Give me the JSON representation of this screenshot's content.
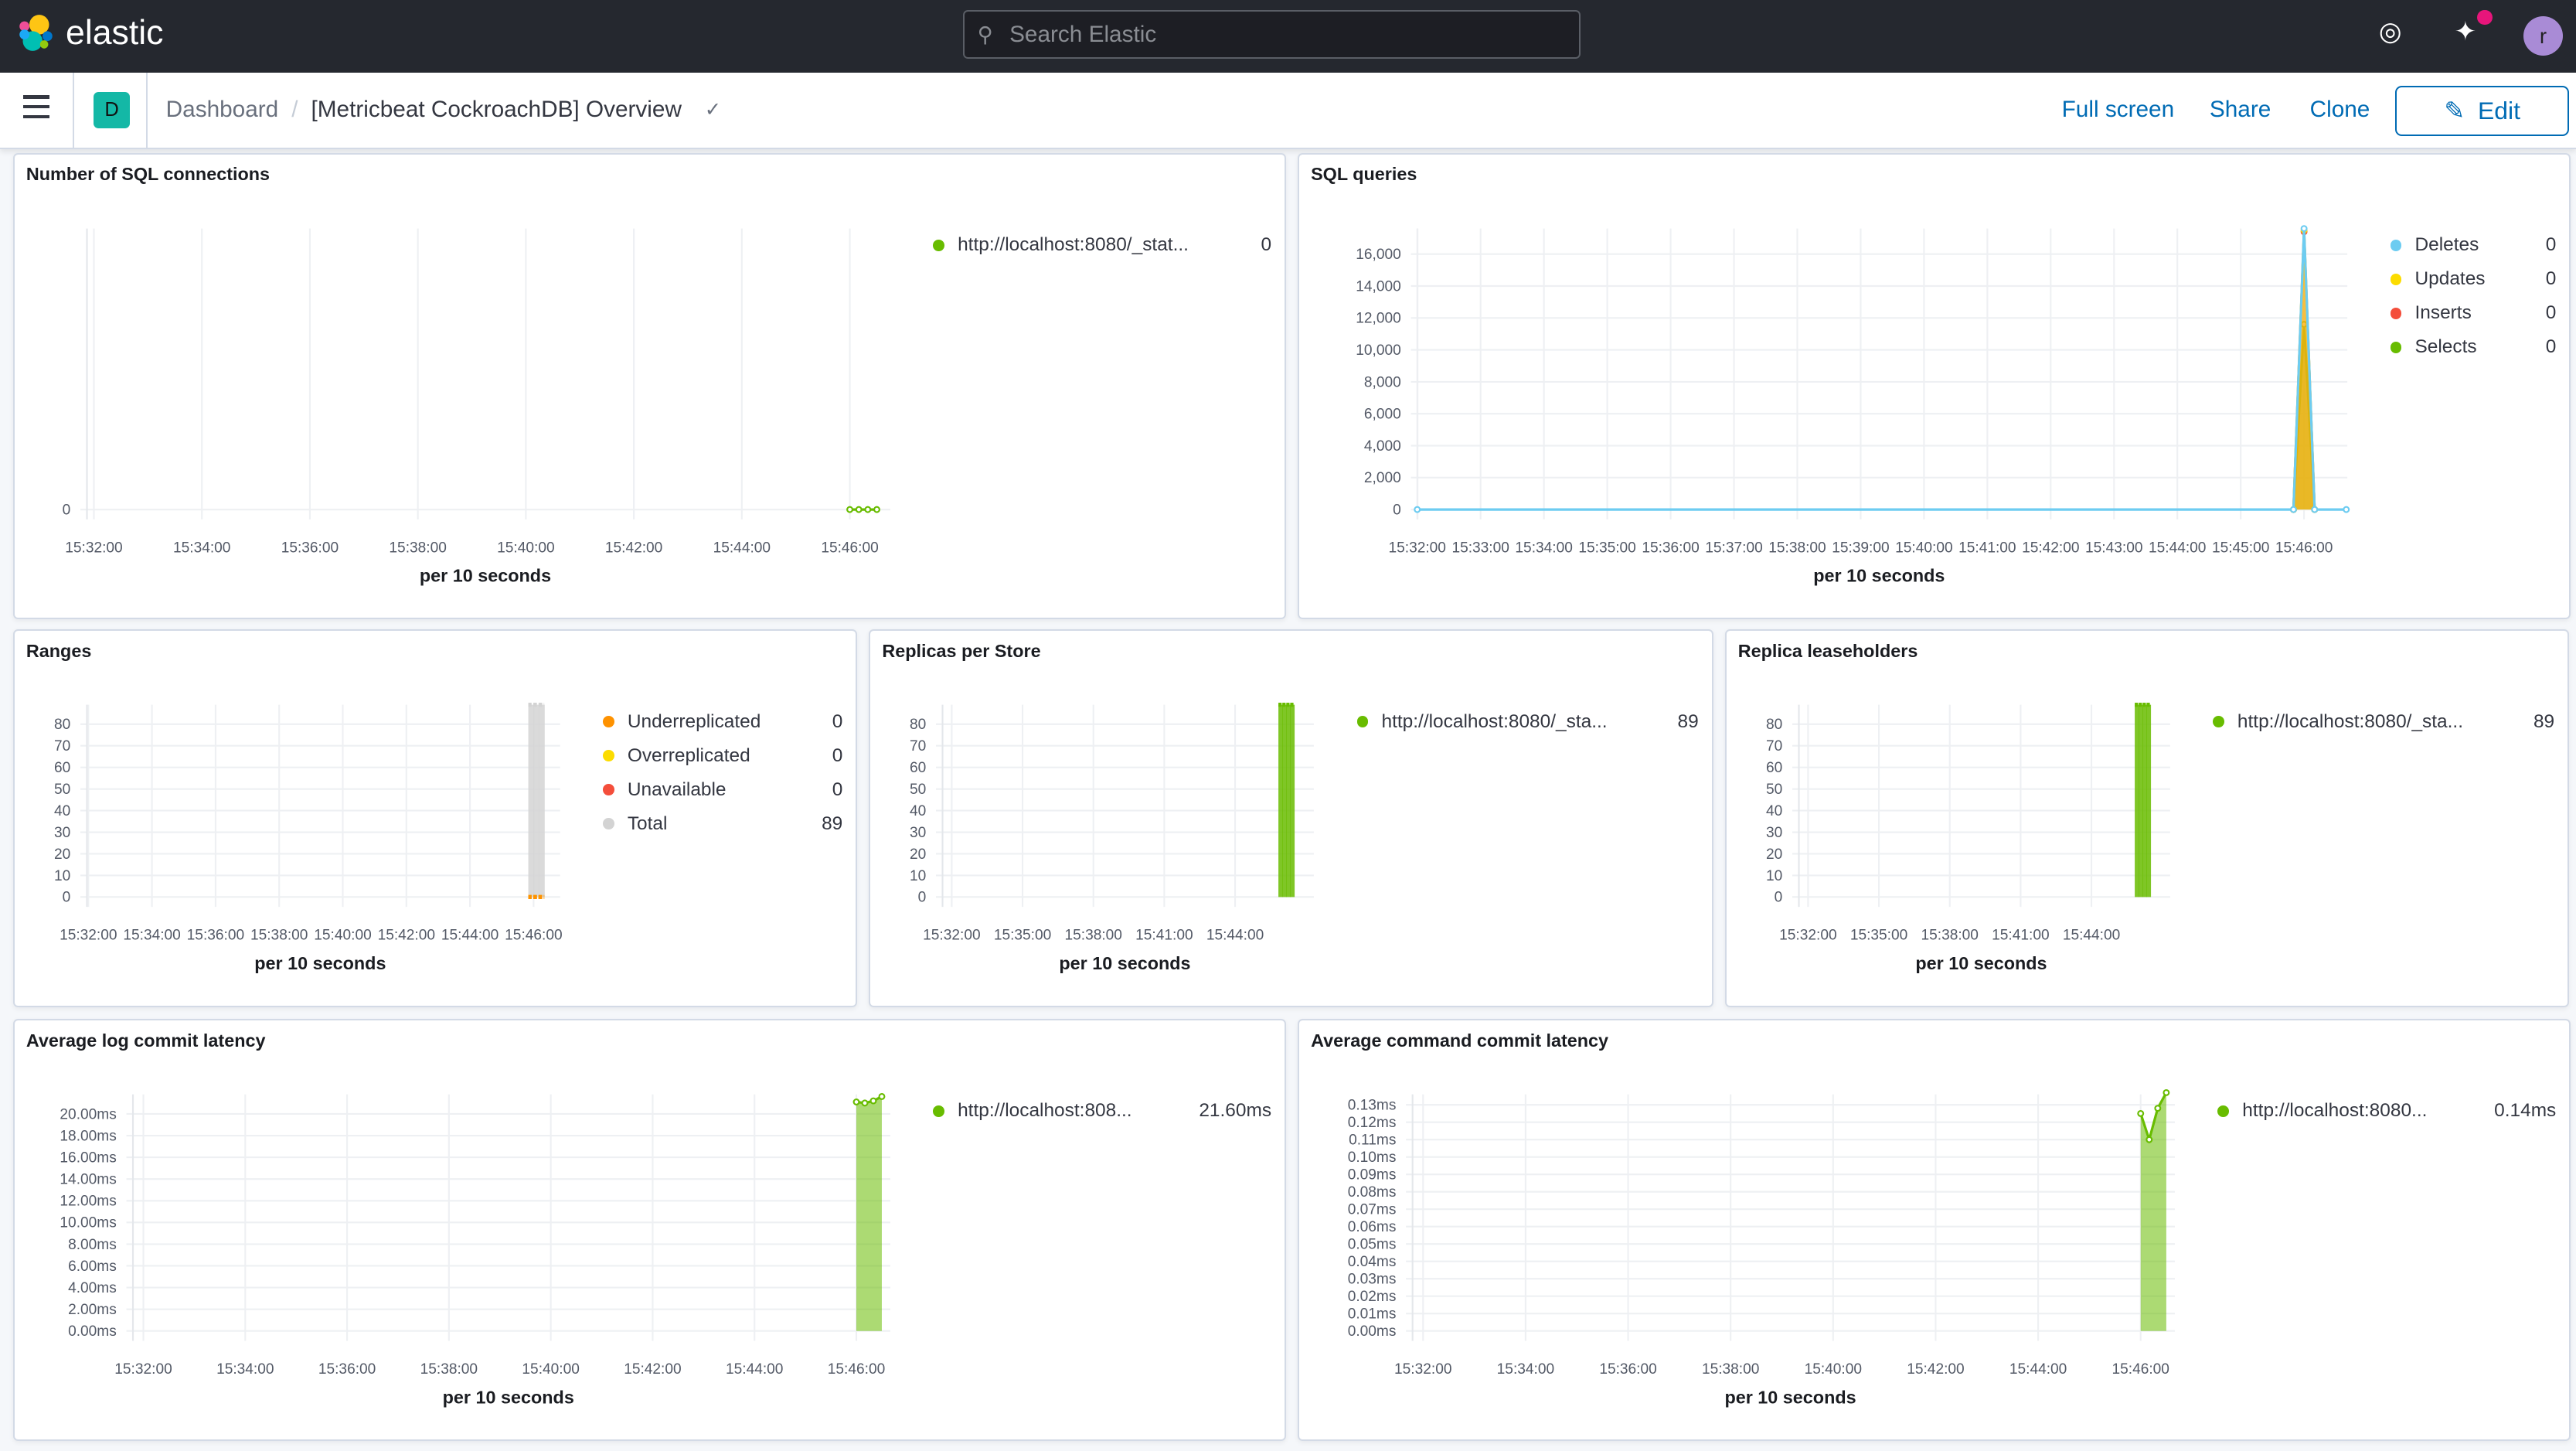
{
  "header": {
    "brand": "elastic",
    "search_placeholder": "Search Elastic",
    "icons": [
      "help-lifebuoy-icon",
      "news-feed-icon",
      "user-avatar"
    ],
    "avatar_initial": "r"
  },
  "subheader": {
    "space_initial": "D",
    "breadcrumb": [
      "Dashboard",
      "[Metricbeat CockroachDB] Overview"
    ],
    "actions": {
      "full_screen": "Full screen",
      "share": "Share",
      "clone": "Clone",
      "edit": "Edit"
    }
  },
  "colors": {
    "accent": "#006bb4",
    "green": "#68BC00",
    "deletes": "#6DCCF1",
    "updates": "#FCDC00",
    "inserts": "#F44E3B",
    "total": "#D3D3D3",
    "underreplicated": "#FE9200"
  },
  "chart_data": [
    {
      "title": "Number of SQL connections",
      "type": "line",
      "xlabel": "per 10 seconds",
      "xlim": [
        "15:31:45",
        "15:46:45"
      ],
      "ylim": [
        0,
        1
      ],
      "yticks": [
        "0"
      ],
      "ytick_values": [
        0
      ],
      "xticks": [
        "15:32:00",
        "15:34:00",
        "15:36:00",
        "15:38:00",
        "15:40:00",
        "15:42:00",
        "15:44:00",
        "15:46:00"
      ],
      "grid": true,
      "legend_position": "right",
      "series": [
        {
          "name": "http://localhost:8080/_stat...",
          "legend_value": "0",
          "color": "#68BC00",
          "kind": "line",
          "points": [
            [
              "15:46:00",
              0
            ],
            [
              "15:46:10",
              0
            ],
            [
              "15:46:20",
              0
            ],
            [
              "15:46:30",
              0
            ]
          ]
        }
      ]
    },
    {
      "title": "SQL queries",
      "type": "area",
      "xlabel": "per 10 seconds",
      "stacked": true,
      "xlim": [
        "15:31:54",
        "15:46:41"
      ],
      "ylim": [
        0,
        17600
      ],
      "yticks": [
        "0",
        "2,000",
        "4,000",
        "6,000",
        "8,000",
        "10,000",
        "12,000",
        "14,000",
        "16,000"
      ],
      "ytick_values": [
        0,
        2000,
        4000,
        6000,
        8000,
        10000,
        12000,
        14000,
        16000
      ],
      "xticks": [
        "15:32:00",
        "15:33:00",
        "15:34:00",
        "15:35:00",
        "15:36:00",
        "15:37:00",
        "15:38:00",
        "15:39:00",
        "15:40:00",
        "15:41:00",
        "15:42:00",
        "15:43:00",
        "15:44:00",
        "15:45:00",
        "15:46:00"
      ],
      "grid": true,
      "legend_position": "right",
      "series": [
        {
          "name": "Deletes",
          "legend_value": "0",
          "color": "#6DCCF1",
          "kind": "line",
          "points": [
            [
              "15:32:00",
              0
            ],
            [
              "15:45:50",
              0
            ],
            [
              "15:46:00",
              17600
            ],
            [
              "15:46:10",
              0
            ],
            [
              "15:46:40",
              0
            ]
          ]
        },
        {
          "name": "Updates",
          "legend_value": "0",
          "color": "#FCDC00",
          "kind": "area",
          "points": [
            [
              "15:45:50",
              0
            ],
            [
              "15:46:00",
              17500
            ],
            [
              "15:46:10",
              0
            ]
          ]
        },
        {
          "name": "Inserts",
          "legend_value": "0",
          "color": "#F44E3B",
          "kind": "area",
          "points": [
            [
              "15:45:50",
              0
            ],
            [
              "15:46:00",
              17400
            ],
            [
              "15:46:10",
              0
            ]
          ]
        },
        {
          "name": "Selects",
          "legend_value": "0",
          "color": "#68BC00",
          "kind": "area",
          "points": [
            [
              "15:45:50",
              0
            ],
            [
              "15:46:00",
              11600
            ],
            [
              "15:46:10",
              0
            ]
          ]
        }
      ]
    },
    {
      "title": "Ranges",
      "type": "bar",
      "xlabel": "per 10 seconds",
      "xlim": [
        "15:31:45",
        "15:46:50"
      ],
      "ylim": [
        0,
        89
      ],
      "yticks": [
        "0",
        "10",
        "20",
        "30",
        "40",
        "50",
        "60",
        "70",
        "80"
      ],
      "ytick_values": [
        0,
        10,
        20,
        30,
        40,
        50,
        60,
        70,
        80
      ],
      "xticks": [
        "15:32:00",
        "15:34:00",
        "15:36:00",
        "15:38:00",
        "15:40:00",
        "15:42:00",
        "15:44:00",
        "15:46:00"
      ],
      "grid": true,
      "legend_position": "right",
      "series": [
        {
          "name": "Underreplicated",
          "legend_value": "0",
          "color": "#FE9200",
          "kind": "bar",
          "points": [
            [
              "15:45:50",
              0
            ],
            [
              "15:46:00",
              0
            ],
            [
              "15:46:10",
              0
            ]
          ]
        },
        {
          "name": "Overreplicated",
          "legend_value": "0",
          "color": "#FCDC00",
          "kind": "bar",
          "points": [
            [
              "15:45:50",
              0
            ],
            [
              "15:46:00",
              0
            ],
            [
              "15:46:10",
              0
            ]
          ]
        },
        {
          "name": "Unavailable",
          "legend_value": "0",
          "color": "#F44E3B",
          "kind": "bar",
          "points": [
            [
              "15:45:50",
              0
            ],
            [
              "15:46:00",
              0
            ],
            [
              "15:46:10",
              0
            ]
          ]
        },
        {
          "name": "Total",
          "legend_value": "89",
          "color": "#D3D3D3",
          "kind": "bar",
          "points": [
            [
              "15:45:50",
              89
            ],
            [
              "15:46:00",
              89
            ],
            [
              "15:46:10",
              89
            ]
          ]
        }
      ]
    },
    {
      "title": "Replicas per Store",
      "type": "bar",
      "xlabel": "per 10 seconds",
      "xlim": [
        "15:31:20",
        "15:47:20"
      ],
      "ylim": [
        0,
        89
      ],
      "yticks": [
        "0",
        "10",
        "20",
        "30",
        "40",
        "50",
        "60",
        "70",
        "80"
      ],
      "ytick_values": [
        0,
        10,
        20,
        30,
        40,
        50,
        60,
        70,
        80
      ],
      "xticks": [
        "15:32:00",
        "15:35:00",
        "15:38:00",
        "15:41:00",
        "15:44:00"
      ],
      "grid": true,
      "legend_position": "right",
      "series": [
        {
          "name": "http://localhost:8080/_sta...",
          "legend_value": "89",
          "color": "#68BC00",
          "kind": "bar",
          "points": [
            [
              "15:45:50",
              89
            ],
            [
              "15:46:00",
              89
            ],
            [
              "15:46:10",
              89
            ],
            [
              "15:46:20",
              89
            ]
          ]
        }
      ]
    },
    {
      "title": "Replica leaseholders",
      "type": "bar",
      "xlabel": "per 10 seconds",
      "xlim": [
        "15:31:20",
        "15:47:20"
      ],
      "ylim": [
        0,
        89
      ],
      "yticks": [
        "0",
        "10",
        "20",
        "30",
        "40",
        "50",
        "60",
        "70",
        "80"
      ],
      "ytick_values": [
        0,
        10,
        20,
        30,
        40,
        50,
        60,
        70,
        80
      ],
      "xticks": [
        "15:32:00",
        "15:35:00",
        "15:38:00",
        "15:41:00",
        "15:44:00"
      ],
      "grid": true,
      "legend_position": "right",
      "series": [
        {
          "name": "http://localhost:8080/_sta...",
          "legend_value": "89",
          "color": "#68BC00",
          "kind": "bar",
          "points": [
            [
              "15:45:50",
              89
            ],
            [
              "15:46:00",
              89
            ],
            [
              "15:46:10",
              89
            ],
            [
              "15:46:20",
              89
            ]
          ]
        }
      ]
    },
    {
      "title": "Average log commit latency",
      "type": "area",
      "xlabel": "per 10 seconds",
      "xlim": [
        "15:31:40",
        "15:46:40"
      ],
      "ylim": [
        0,
        21.8
      ],
      "yticks": [
        "0.00ms",
        "2.00ms",
        "4.00ms",
        "6.00ms",
        "8.00ms",
        "10.00ms",
        "12.00ms",
        "14.00ms",
        "16.00ms",
        "18.00ms",
        "20.00ms"
      ],
      "ytick_values": [
        0,
        2,
        4,
        6,
        8,
        10,
        12,
        14,
        16,
        18,
        20
      ],
      "xticks": [
        "15:32:00",
        "15:34:00",
        "15:36:00",
        "15:38:00",
        "15:40:00",
        "15:42:00",
        "15:44:00",
        "15:46:00"
      ],
      "grid": true,
      "legend_position": "right",
      "series": [
        {
          "name": "http://localhost:808...",
          "legend_value": "21.60ms",
          "color": "#68BC00",
          "kind": "area",
          "points": [
            [
              "15:46:00",
              21.1
            ],
            [
              "15:46:10",
              21.0
            ],
            [
              "15:46:20",
              21.2
            ],
            [
              "15:46:30",
              21.6
            ]
          ]
        }
      ]
    },
    {
      "title": "Average command commit latency",
      "type": "area",
      "xlabel": "per 10 seconds",
      "xlim": [
        "15:31:40",
        "15:46:40"
      ],
      "ylim": [
        0,
        0.136
      ],
      "yticks": [
        "0.00ms",
        "0.01ms",
        "0.02ms",
        "0.03ms",
        "0.04ms",
        "0.05ms",
        "0.06ms",
        "0.07ms",
        "0.08ms",
        "0.09ms",
        "0.10ms",
        "0.11ms",
        "0.12ms",
        "0.13ms"
      ],
      "ytick_values": [
        0,
        0.01,
        0.02,
        0.03,
        0.04,
        0.05,
        0.06,
        0.07,
        0.08,
        0.09,
        0.1,
        0.11,
        0.12,
        0.13
      ],
      "xticks": [
        "15:32:00",
        "15:34:00",
        "15:36:00",
        "15:38:00",
        "15:40:00",
        "15:42:00",
        "15:44:00",
        "15:46:00"
      ],
      "grid": true,
      "legend_position": "right",
      "series": [
        {
          "name": "http://localhost:8080...",
          "legend_value": "0.14ms",
          "color": "#68BC00",
          "kind": "area",
          "points": [
            [
              "15:46:00",
              0.125
            ],
            [
              "15:46:10",
              0.11
            ],
            [
              "15:46:20",
              0.128
            ],
            [
              "15:46:30",
              0.137
            ]
          ]
        }
      ]
    }
  ]
}
